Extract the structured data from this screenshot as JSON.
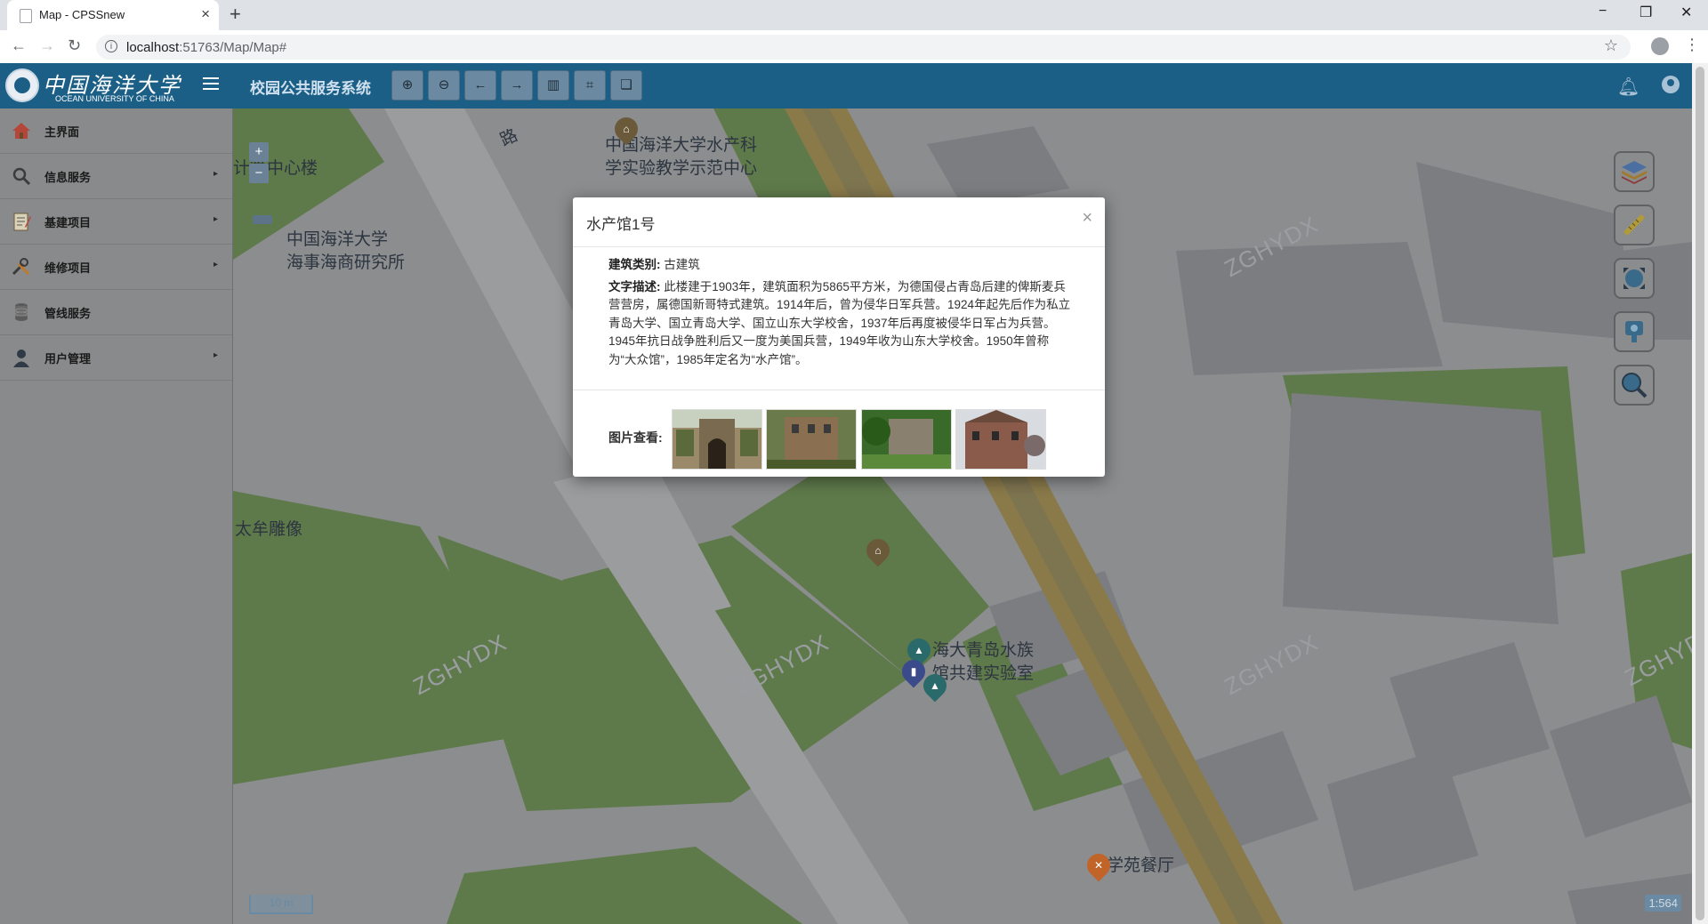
{
  "browser": {
    "tab_title": "Map - CPSSnew",
    "tab_close": "×",
    "new_tab": "+",
    "url_host": "localhost",
    "url_path": ":51763/Map/Map#",
    "controls": {
      "minimize": "−",
      "restore": "❐",
      "close": "✕"
    }
  },
  "header": {
    "logo_cn": "中国海洋大学",
    "logo_en": "OCEAN UNIVERSITY OF CHINA",
    "system_title": "校园公共服务系统",
    "toolbar": [
      {
        "icon": "zoom-in-icon",
        "glyph": "⊕"
      },
      {
        "icon": "zoom-out-icon",
        "glyph": "⊖"
      },
      {
        "icon": "arrow-left-icon",
        "glyph": "←"
      },
      {
        "icon": "arrow-right-icon",
        "glyph": "→"
      },
      {
        "icon": "map-icon",
        "glyph": "▥"
      },
      {
        "icon": "crop-icon",
        "glyph": "⌗"
      },
      {
        "icon": "copy-icon",
        "glyph": "❏"
      }
    ]
  },
  "sidebar": {
    "items": [
      {
        "label": "主界面",
        "icon": "home-icon",
        "has_arrow": false
      },
      {
        "label": "信息服务",
        "icon": "search-icon",
        "has_arrow": true
      },
      {
        "label": "基建项目",
        "icon": "clipboard-icon",
        "has_arrow": true
      },
      {
        "label": "维修项目",
        "icon": "tools-icon",
        "has_arrow": true
      },
      {
        "label": "管线服务",
        "icon": "database-icon",
        "has_arrow": false
      },
      {
        "label": "用户管理",
        "icon": "user-icon",
        "has_arrow": true
      }
    ],
    "arrow": "▸"
  },
  "map": {
    "labels": {
      "road": "路",
      "aquaculture_center_1": "中国海洋大学水产科",
      "aquaculture_center_2": "学实验教学示范中心",
      "computing_center": "计算中心楼",
      "maritime_1": "中国海洋大学",
      "maritime_2": "海事海商研究所",
      "statue": "太牟雕像",
      "lab_1": "海大青岛水族",
      "lab_2": "馆共建实验室",
      "canteen": "学苑餐厅"
    },
    "watermark": "ZGHYDX",
    "scale_line": "10 m",
    "scale_ratio": "1:564",
    "zoom_in": "+",
    "zoom_out": "−",
    "colors": {
      "green": "#5f7a4a",
      "building": "#7b7d80",
      "road": "#9a9c9e",
      "orange_road": "#8a7a4a"
    }
  },
  "popup": {
    "title": "水产馆1号",
    "close": "×",
    "category_label": "建筑类别:",
    "category_value": "古建筑",
    "desc_label": "文字描述:",
    "desc_value": "此楼建于1903年，建筑面积为5865平方米，为德国侵占青岛后建的俾斯麦兵营营房，属德国新哥特式建筑。1914年后，曾为侵华日军兵营。1924年起先后作为私立青岛大学、国立青岛大学、国立山东大学校舍，1937年后再度被侵华日军占为兵营。1945年抗日战争胜利后又一度为美国兵营，1949年收为山东大学校舍。1950年曾称为“大众馆”，1985年定名为“水产馆”。",
    "photos_label": "图片查看:",
    "photos": [
      "photo-1",
      "photo-2",
      "photo-3",
      "photo-4"
    ]
  }
}
